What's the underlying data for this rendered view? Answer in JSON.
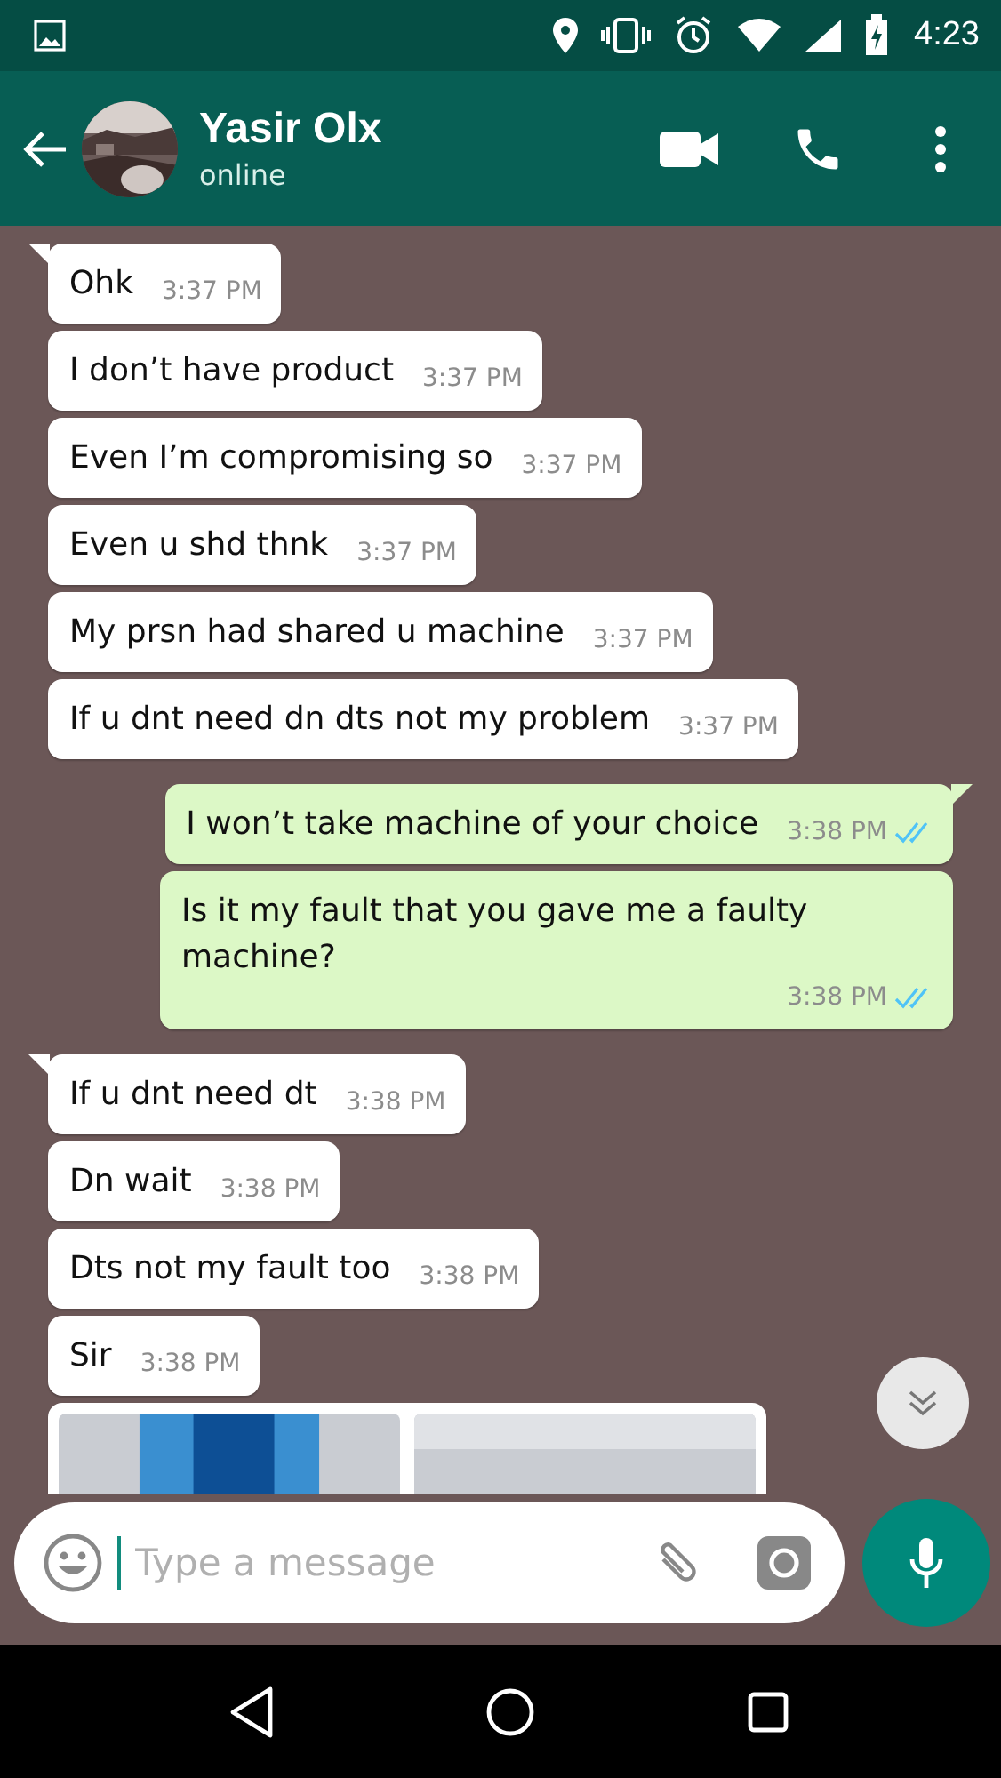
{
  "status_bar": {
    "time": "4:23"
  },
  "header": {
    "name": "Yasir Olx",
    "presence": "online"
  },
  "messages": [
    {
      "kind": "incoming",
      "text": "Ohk",
      "time": "3:37 PM"
    },
    {
      "kind": "incoming",
      "text": "I don’t have product",
      "time": "3:37 PM"
    },
    {
      "kind": "incoming",
      "text": "Even I’m compromising so",
      "time": "3:37 PM"
    },
    {
      "kind": "incoming",
      "text": "Even u shd thnk",
      "time": "3:37 PM"
    },
    {
      "kind": "incoming",
      "text": "My prsn had shared u machine",
      "time": "3:37 PM"
    },
    {
      "kind": "incoming",
      "text": "If u dnt need dn dts not my problem",
      "time": "3:37 PM"
    },
    {
      "kind": "outgoing",
      "text": "I won’t take machine of your choice",
      "time": "3:38 PM",
      "read": true
    },
    {
      "kind": "outgoing",
      "text": "Is it my fault that you gave me a faulty machine?",
      "time": "3:38 PM",
      "read": true
    },
    {
      "kind": "incoming",
      "text": "If u dnt need dt",
      "time": "3:38 PM"
    },
    {
      "kind": "incoming",
      "text": "Dn wait",
      "time": "3:38 PM"
    },
    {
      "kind": "incoming",
      "text": "Dts not my fault too",
      "time": "3:38 PM"
    },
    {
      "kind": "incoming",
      "text": "Sir",
      "time": "3:38 PM"
    },
    {
      "kind": "images"
    }
  ],
  "composer": {
    "placeholder": "Type a message"
  }
}
